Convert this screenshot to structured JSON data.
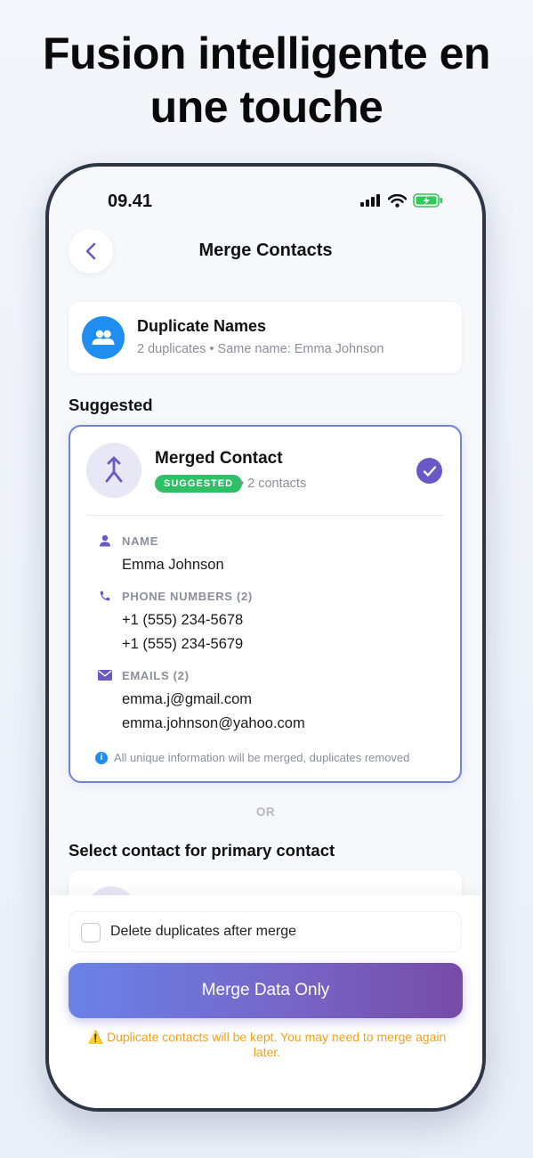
{
  "promo": {
    "title_line1": "Fusion intelligente en",
    "title_line2": "une touche"
  },
  "status_bar": {
    "time": "09.41",
    "icons": [
      "cellular-signal-icon",
      "wifi-icon",
      "battery-charging-icon"
    ]
  },
  "nav": {
    "title": "Merge Contacts",
    "back_icon": "chevron-left-icon"
  },
  "duplicate_group": {
    "icon": "people-icon",
    "title": "Duplicate Names",
    "subtitle": "2 duplicates • Same name: Emma Johnson"
  },
  "suggested_section": {
    "heading": "Suggested"
  },
  "merged_contact": {
    "icon": "merge-arrow-icon",
    "title": "Merged Contact",
    "badge": "SUGGESTED",
    "contact_count": "• 2 contacts",
    "selected": true,
    "fields": {
      "name": {
        "label": "NAME",
        "value": "Emma Johnson",
        "icon": "person-icon"
      },
      "phones": {
        "label": "PHONE NUMBERS (2)",
        "values": [
          "+1 (555) 234-5678",
          "+1 (555) 234-5679"
        ],
        "icon": "phone-icon"
      },
      "emails": {
        "label": "EMAILS (2)",
        "values": [
          "emma.j@gmail.com",
          "emma.johnson@yahoo.com"
        ],
        "icon": "envelope-icon"
      }
    },
    "info_note": "All unique information will be merged, duplicates removed"
  },
  "or_divider": "OR",
  "primary_section": {
    "heading": "Select contact for primary contact"
  },
  "bottom": {
    "delete_checkbox_label": "Delete duplicates after merge",
    "delete_checked": false,
    "merge_button_label": "Merge Data Only",
    "warning_icon": "⚠️",
    "warning_text": "Duplicate contacts will be kept. You may need to merge again later."
  },
  "colors": {
    "accent_purple": "#6a58c6",
    "card_border": "#6f82de",
    "badge_green": "#2fbf67",
    "icon_blue": "#1f8ef0",
    "warning_orange": "#f1a21c",
    "button_gradient_start": "#6a82e6",
    "button_gradient_end": "#764ca6"
  }
}
